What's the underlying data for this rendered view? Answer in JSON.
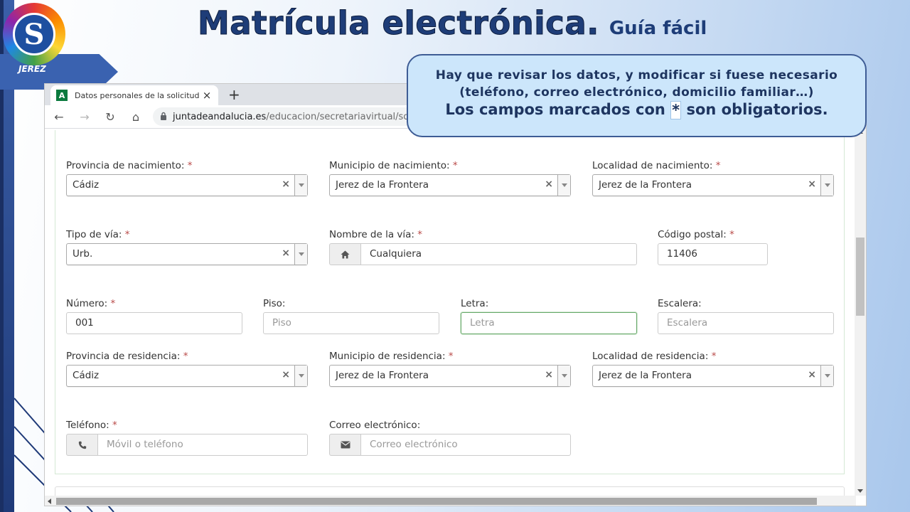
{
  "slide": {
    "title": "Matrícula electrónica.",
    "subtitle": "Guía fácil",
    "logo_letter": "S",
    "logo_text": "JEREZ"
  },
  "callout": {
    "line1": "Hay que revisar los datos, y modificar si fuese necesario",
    "line2": "(teléfono, correo electrónico, domicilio familiar…)",
    "line3_before": "Los campos marcados con",
    "line3_star": "*",
    "line3_after": "son obligatorios."
  },
  "browser": {
    "tab_favicon": "A",
    "tab_title": "Datos personales de la solicitud",
    "tab_close": "×",
    "new_tab": "+",
    "back": "←",
    "forward": "→",
    "reload": "↻",
    "home": "⌂",
    "lock": "🔒",
    "url_domain": "juntadeandalucia.es",
    "url_path": "/educacion/secretariavirtual/solicitud..."
  },
  "form": {
    "required_mark": "*",
    "provincia_nacimiento": {
      "label": "Provincia de nacimiento:",
      "value": "Cádiz"
    },
    "municipio_nacimiento": {
      "label": "Municipio de nacimiento:",
      "value": "Jerez de la Frontera"
    },
    "localidad_nacimiento": {
      "label": "Localidad de nacimiento:",
      "value": "Jerez de la Frontera"
    },
    "tipo_via": {
      "label": "Tipo de vía:",
      "value": "Urb."
    },
    "nombre_via": {
      "label": "Nombre de la vía:",
      "value": "Cualquiera",
      "icon": "home-icon"
    },
    "codigo_postal": {
      "label": "Código postal:",
      "value": "11406"
    },
    "numero": {
      "label": "Número:",
      "value": "001"
    },
    "piso": {
      "label": "Piso:",
      "placeholder": "Piso"
    },
    "letra": {
      "label": "Letra:",
      "placeholder": "Letra"
    },
    "escalera": {
      "label": "Escalera:",
      "placeholder": "Escalera"
    },
    "provincia_residencia": {
      "label": "Provincia de residencia:",
      "value": "Cádiz"
    },
    "municipio_residencia": {
      "label": "Municipio de residencia:",
      "value": "Jerez de la Frontera"
    },
    "localidad_residencia": {
      "label": "Localidad de residencia:",
      "value": "Jerez de la Frontera"
    },
    "telefono": {
      "label": "Teléfono:",
      "placeholder": "Móvil o teléfono",
      "icon": "phone-icon"
    },
    "correo": {
      "label": "Correo electrónico:",
      "placeholder": "Correo electrónico",
      "icon": "envelope-icon"
    },
    "clear_glyph": "×"
  },
  "colors": {
    "title": "#1e3d78",
    "callout_bg": "#cce6fb",
    "callout_border": "#3e5c95",
    "required": "#b94a48",
    "focus_border": "#66a868"
  }
}
